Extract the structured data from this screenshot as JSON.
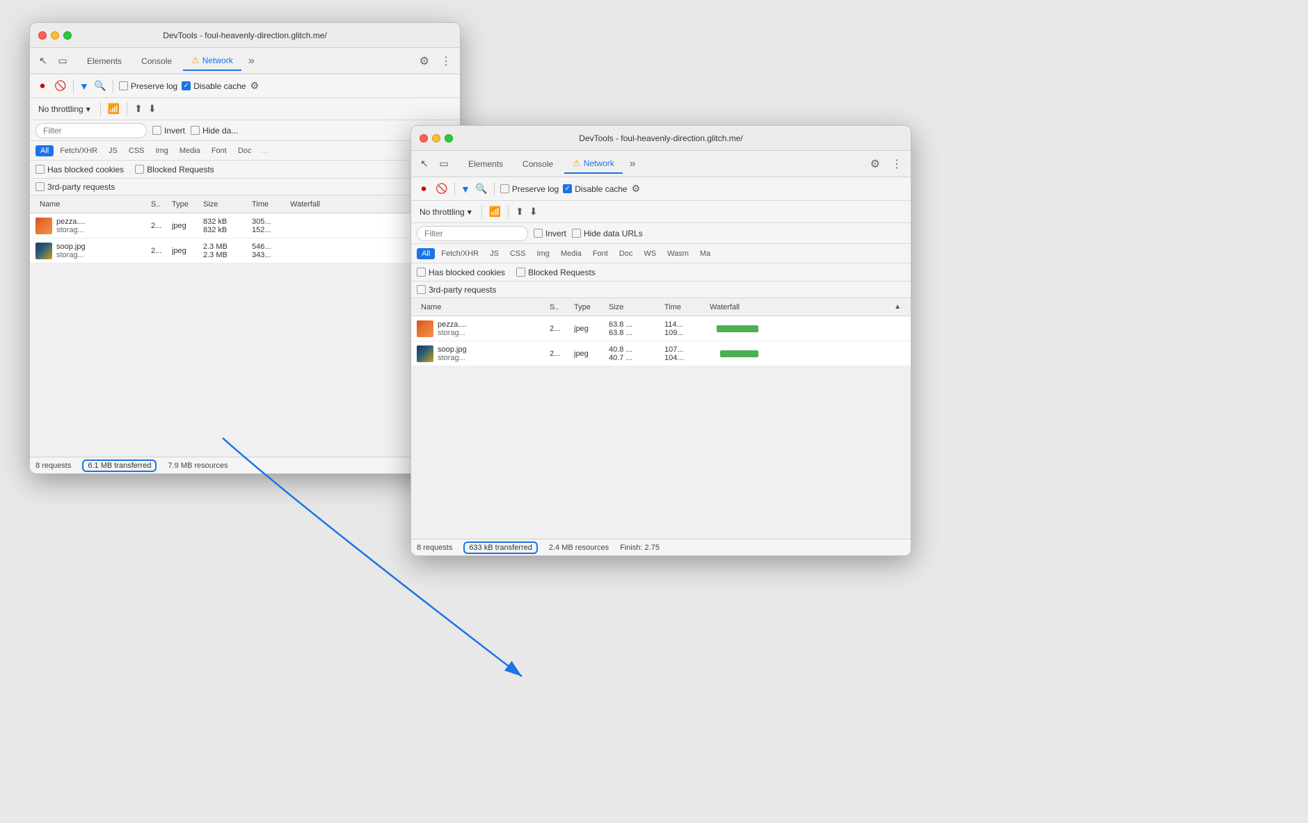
{
  "window_back": {
    "title": "DevTools - foul-heavenly-direction.glitch.me/",
    "tabs": {
      "elements": "Elements",
      "console": "Console",
      "network": "Network",
      "active": "network"
    },
    "toolbar": {
      "preserve_log": "Preserve log",
      "disable_cache": "Disable cache"
    },
    "throttling": {
      "label": "No throttling"
    },
    "filter_placeholder": "Filter",
    "type_filters": [
      "All",
      "Fetch/XHR",
      "JS",
      "CSS",
      "Img",
      "Media",
      "Font",
      "Doc"
    ],
    "checks": {
      "blocked_cookies": "Has blocked cookies",
      "blocked_requests": "Blocked Requests",
      "third_party": "3rd-party requests"
    },
    "table": {
      "headers": [
        "Name",
        "S..",
        "Type",
        "Size",
        "Time",
        "Waterfall"
      ],
      "rows": [
        {
          "name_line1": "pezza....",
          "name_line2": "storag...",
          "status": "2...",
          "type": "jpeg",
          "size_line1": "832 kB",
          "size_line2": "832 kB",
          "time_line1": "305...",
          "time_line2": "152..."
        },
        {
          "name_line1": "soop.jpg",
          "name_line2": "storag...",
          "status": "2...",
          "type": "jpeg",
          "size_line1": "2.3 MB",
          "size_line2": "2.3 MB",
          "time_line1": "546...",
          "time_line2": "343..."
        }
      ]
    },
    "status_bar": {
      "requests": "8 requests",
      "transferred": "6.1 MB transferred",
      "resources": "7.9 MB resources"
    }
  },
  "window_front": {
    "title": "DevTools - foul-heavenly-direction.glitch.me/",
    "tabs": {
      "elements": "Elements",
      "console": "Console",
      "network": "Network",
      "active": "network"
    },
    "toolbar": {
      "preserve_log": "Preserve log",
      "disable_cache": "Disable cache"
    },
    "throttling": {
      "label": "No throttling"
    },
    "filter_placeholder": "Filter",
    "type_filters": [
      "All",
      "Fetch/XHR",
      "JS",
      "CSS",
      "Img",
      "Media",
      "Font",
      "Doc",
      "WS",
      "Wasm",
      "Ma"
    ],
    "checks": {
      "blocked_cookies": "Has blocked cookies",
      "blocked_requests": "Blocked Requests",
      "third_party": "3rd-party requests"
    },
    "table": {
      "headers": [
        "Name",
        "S..",
        "Type",
        "Size",
        "Time",
        "Waterfall"
      ],
      "rows": [
        {
          "name_line1": "pezza....",
          "name_line2": "storag...",
          "status": "2...",
          "type": "jpeg",
          "size_line1": "63.8 ...",
          "size_line2": "63.8 ...",
          "time_line1": "114...",
          "time_line2": "109..."
        },
        {
          "name_line1": "soop.jpg",
          "name_line2": "storag...",
          "status": "2...",
          "type": "jpeg",
          "size_line1": "40.8 ...",
          "size_line2": "40.7 ...",
          "time_line1": "107...",
          "time_line2": "104..."
        }
      ]
    },
    "status_bar": {
      "requests": "8 requests",
      "transferred": "633 kB transferred",
      "resources": "2.4 MB resources",
      "finish": "Finish: 2.75"
    }
  },
  "invert_label": "Invert",
  "hide_data_urls": "Hide data URLs",
  "hide_data_urls_front": "Hide data URLs"
}
